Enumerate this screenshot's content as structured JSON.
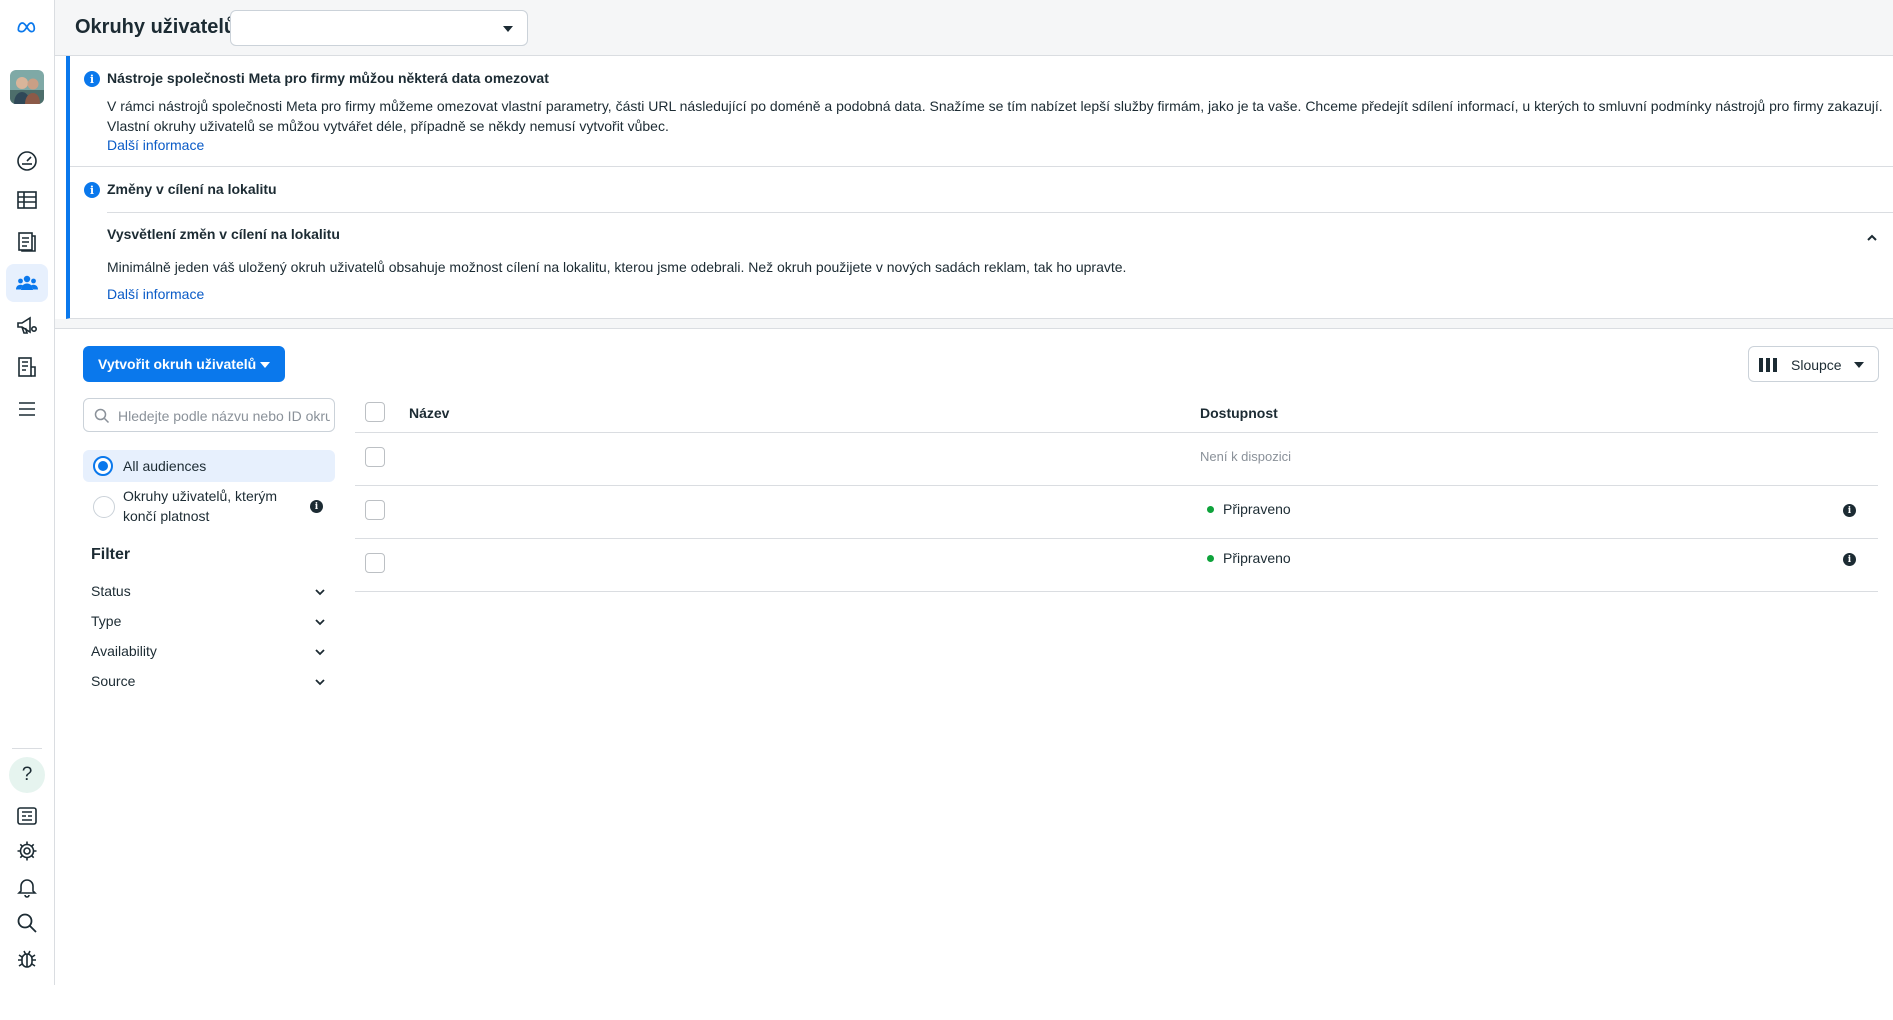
{
  "header": {
    "title": "Okruhy uživatelů",
    "account_selector_value": ""
  },
  "notices": [
    {
      "title": "Nástroje společnosti Meta pro firmy můžou některá data omezovat",
      "text": "V rámci nástrojů společnosti Meta pro firmy můžeme omezovat vlastní parametry, části URL následující po doméně a podobná data. Snažíme se tím nabízet lepší služby firmám, jako je ta vaše. Chceme předejít sdílení informací, u kterých to smluvní podmínky nástrojů pro firmy zakazují. Vlastní okruhy uživatelů se můžou vytvářet déle, případně se někdy nemusí vytvořit vůbec.",
      "link": "Další informace"
    },
    {
      "title": "Změny v cílení na lokalitu",
      "subtitle": "Vysvětlení změn v cílení na lokalitu",
      "text": "Minimálně jeden váš uložený okruh uživatelů obsahuje možnost cílení na lokalitu, kterou jsme odebrali. Než okruh použijete v nových sadách reklam, tak ho upravte.",
      "link": "Další informace"
    }
  ],
  "toolbar": {
    "create_label": "Vytvořit okruh uživatelů",
    "columns_label": "Sloupce"
  },
  "search": {
    "placeholder": "Hledejte podle názvu nebo ID okruhu uživatelů",
    "value": ""
  },
  "audience_filter": {
    "options": [
      {
        "label": "All audiences",
        "selected": true
      },
      {
        "label": "Okruhy uživatelů, kterým končí platnost",
        "selected": false
      }
    ]
  },
  "filter": {
    "title": "Filter",
    "items": [
      "Status",
      "Type",
      "Availability",
      "Source"
    ]
  },
  "table": {
    "columns": [
      "Název",
      "Dostupnost"
    ],
    "rows": [
      {
        "name": "",
        "availability": "Není k dispozici",
        "status_color": ""
      },
      {
        "name": "",
        "availability": "Připraveno",
        "status_color": "#0ea33b"
      },
      {
        "name": "",
        "availability": "Připraveno",
        "status_color": "#0ea33b"
      }
    ]
  },
  "colors": {
    "accent": "#0a78ec",
    "link": "#0a5bc7",
    "ready": "#0ea33b"
  },
  "icons": {
    "rail_top": [
      "meta-logo-icon",
      "avatar",
      "dashboard-gauge-icon",
      "table-icon",
      "catalog-icon",
      "audiences-icon",
      "megaphone-icon",
      "billing-icon",
      "menu-icon"
    ],
    "rail_bottom": [
      "help-icon",
      "news-icon",
      "settings-icon",
      "bell-icon",
      "search-icon",
      "bug-icon"
    ]
  }
}
